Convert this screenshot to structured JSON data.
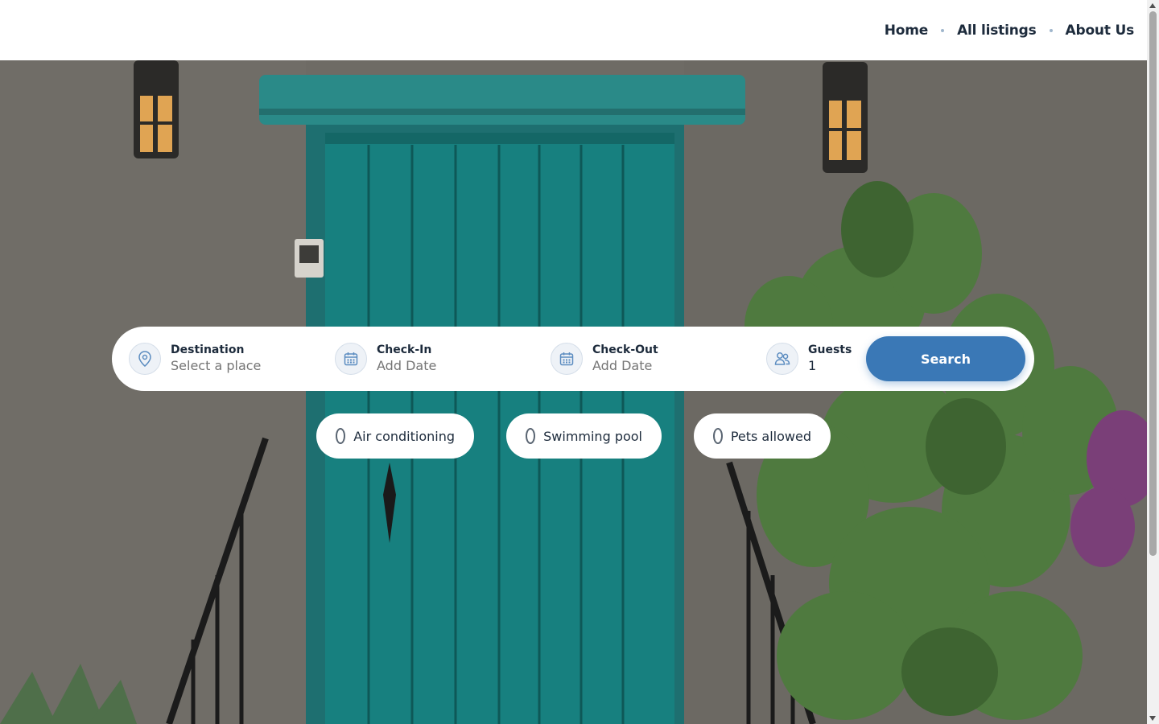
{
  "nav": {
    "items": [
      {
        "label": "Home"
      },
      {
        "label": "All listings"
      },
      {
        "label": "About Us"
      }
    ]
  },
  "search": {
    "destination": {
      "label": "Destination",
      "placeholder": "Select a place",
      "icon": "location-pin-icon"
    },
    "check_in": {
      "label": "Check-In",
      "placeholder": "Add Date",
      "icon": "calendar-icon"
    },
    "check_out": {
      "label": "Check-Out",
      "placeholder": "Add Date",
      "icon": "calendar-icon"
    },
    "guests": {
      "label": "Guests",
      "value": "1",
      "icon": "users-icon"
    },
    "button_label": "Search"
  },
  "amenities": [
    {
      "label": "Air conditioning",
      "checked": false
    },
    {
      "label": "Swimming pool",
      "checked": false
    },
    {
      "label": "Pets allowed",
      "checked": false
    }
  ],
  "colors": {
    "accent": "#3a78b6",
    "text": "#1d2b3c",
    "muted": "#8a96a3",
    "door": "#1a7f7d"
  }
}
